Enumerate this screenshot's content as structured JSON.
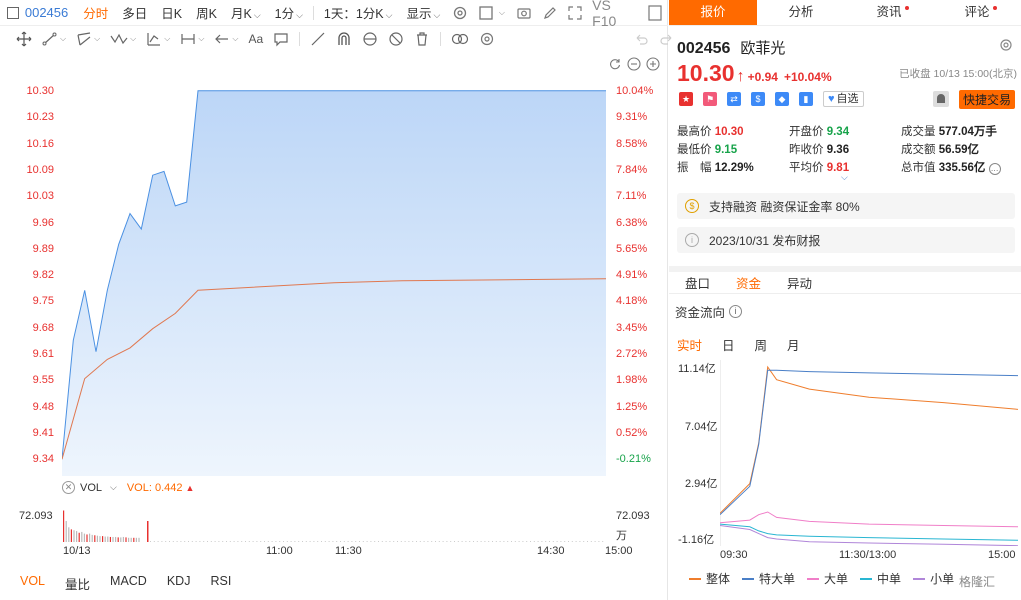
{
  "toolbar": {
    "code": "002456",
    "periods": [
      "分时",
      "多日",
      "日K",
      "周K",
      "月K",
      "1分"
    ],
    "active_period": "分时",
    "interval": "1天：1分K",
    "display": "显示",
    "vs": "VS F10"
  },
  "chart": {
    "y_left": [
      "10.30",
      "10.23",
      "10.16",
      "10.09",
      "10.03",
      "9.96",
      "9.89",
      "9.82",
      "9.75",
      "9.68",
      "9.61",
      "9.55",
      "9.48",
      "9.41",
      "9.34"
    ],
    "y_right": [
      "10.04%",
      "9.31%",
      "8.58%",
      "7.84%",
      "7.11%",
      "6.38%",
      "5.65%",
      "4.91%",
      "4.18%",
      "3.45%",
      "2.72%",
      "1.98%",
      "1.25%",
      "0.52%",
      "-0.21%"
    ],
    "vol_indicator": "VOL",
    "vol_value_label": "VOL: 0.442",
    "vol_max_left": "72.093",
    "vol_max_right": "72.093",
    "vol_unit": "万",
    "x_labels": [
      "10/13",
      "11:00",
      "11:30",
      "14:30",
      "15:00"
    ],
    "indicators": [
      "VOL",
      "量比",
      "MACD",
      "KDJ",
      "RSI"
    ],
    "active_indicator": "VOL"
  },
  "chart_data": [
    {
      "type": "line",
      "title": "",
      "series": [
        {
          "name": "",
          "color": "#4a90e2",
          "x": [
            "09:30",
            "09:35",
            "09:40",
            "09:45",
            "09:50",
            "09:55",
            "10:00",
            "10:05",
            "10:10",
            "10:15",
            "10:20",
            "10:25",
            "10:30",
            "11:30",
            "15:00"
          ],
          "values": [
            9.34,
            9.65,
            9.78,
            9.62,
            9.78,
            9.9,
            9.98,
            9.94,
            10.08,
            10.09,
            10.0,
            10.01,
            10.3,
            10.3,
            10.3
          ]
        },
        {
          "name": "",
          "color": "#e07850",
          "x": [
            "09:30",
            "09:40",
            "09:50",
            "10:00",
            "10:10",
            "10:20",
            "10:30",
            "11:30",
            "13:30",
            "15:00"
          ],
          "values": [
            9.34,
            9.55,
            9.6,
            9.63,
            9.68,
            9.72,
            9.78,
            9.8,
            9.805,
            9.81
          ]
        }
      ],
      "ylim": [
        9.33,
        10.31
      ]
    },
    {
      "type": "bar",
      "title": "",
      "x": [
        "09:30",
        "10:30"
      ],
      "values": [
        72.093,
        72.093
      ],
      "ylabel": "万"
    },
    {
      "type": "line",
      "title": "资金流向",
      "x": [
        "09:30",
        "09:40",
        "09:50",
        "10:00",
        "10:05",
        "10:30",
        "11:30/13:00",
        "14:00",
        "15:00"
      ],
      "series": [
        {
          "name": "整体",
          "color": "#ef7d2c",
          "values": [
            0.3,
            2.5,
            5.5,
            11.14,
            10.2,
            9.5,
            8.9,
            8.5,
            8.0
          ]
        },
        {
          "name": "特大单",
          "color": "#4a7fc7",
          "values": [
            0.2,
            2.3,
            5.4,
            10.9,
            10.9,
            10.8,
            10.7,
            10.6,
            10.5
          ]
        },
        {
          "name": "大单",
          "color": "#f07ec8",
          "values": [
            -0.4,
            -0.2,
            0.2,
            0.4,
            0.0,
            -0.3,
            -0.5,
            -0.6,
            -0.7
          ]
        },
        {
          "name": "中单",
          "color": "#29b6d2",
          "values": [
            -0.5,
            -0.7,
            -1.0,
            -1.2,
            -1.3,
            -1.4,
            -1.5,
            -1.6,
            -1.7
          ]
        },
        {
          "name": "小单",
          "color": "#b086d9",
          "values": [
            -0.6,
            -0.9,
            -1.2,
            -1.5,
            -1.6,
            -1.8,
            -1.9,
            -2.0,
            -2.1
          ]
        }
      ],
      "y_ticks": [
        "11.14亿",
        "7.04亿",
        "2.94亿",
        "-1.16亿"
      ],
      "x_ticks": [
        "09:30",
        "11:30/13:00",
        "15:00"
      ]
    }
  ],
  "right": {
    "tabs": [
      {
        "label": "报价",
        "active": true,
        "dot": false
      },
      {
        "label": "分析",
        "active": false,
        "dot": false
      },
      {
        "label": "资讯",
        "active": false,
        "dot": true
      },
      {
        "label": "评论",
        "active": false,
        "dot": true
      }
    ],
    "code": "002456",
    "name": "欧菲光",
    "price": "10.30",
    "change": "+0.94",
    "change_pct": "+10.04%",
    "time_note": "已收盘 10/13 15:00(北京)",
    "zixuan": "自选",
    "quick_trade": "快捷交易",
    "stats": [
      [
        {
          "label": "最高价",
          "value": "10.30",
          "color": "red"
        },
        {
          "label": "开盘价",
          "value": "9.34",
          "color": "green"
        },
        {
          "label": "成交量",
          "value": "577.04万手",
          "color": "dark"
        }
      ],
      [
        {
          "label": "最低价",
          "value": "9.15",
          "color": "green"
        },
        {
          "label": "昨收价",
          "value": "9.36",
          "color": "dark"
        },
        {
          "label": "成交额",
          "value": "56.59亿",
          "color": "dark"
        }
      ],
      [
        {
          "label": "振　幅",
          "value": "12.29%",
          "color": "dark"
        },
        {
          "label": "平均价",
          "value": "9.81",
          "color": "red"
        },
        {
          "label": "总市值",
          "value": "335.56亿",
          "color": "dark"
        }
      ]
    ],
    "margin_info": "支持融资 融资保证金率 80%",
    "report_info": "2023/10/31  发布财报",
    "sub_tabs": [
      "盘口",
      "资金",
      "异动"
    ],
    "active_sub_tab": "资金",
    "flow_title": "资金流向",
    "period_tabs": [
      "实时",
      "日",
      "周",
      "月"
    ],
    "active_period_tab": "实时",
    "watermark": "格隆汇"
  }
}
